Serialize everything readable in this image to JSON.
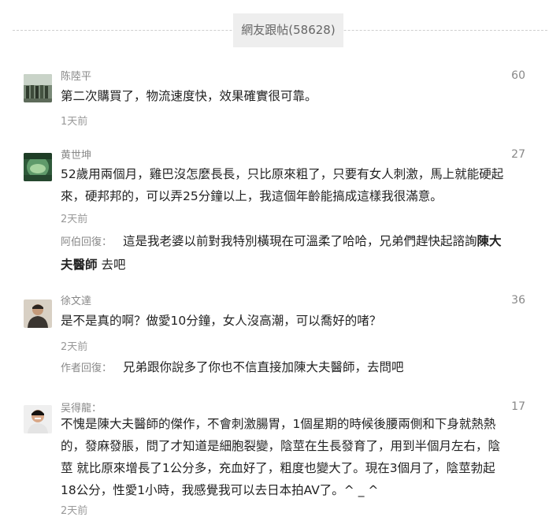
{
  "header": {
    "title": "網友跟帖(58628)"
  },
  "comments": [
    {
      "user": "陈陸平",
      "likes": "60",
      "content": "第二次購買了，物流速度快，效果確實很可靠。",
      "time": "1天前"
    },
    {
      "user": "黄世坤",
      "likes": "27",
      "content_line1": "52歲用兩個月，雞巴沒怎麼長長，只比原來粗了，只要有女人刺激，馬上就能硬起",
      "content_line2": "來，硬邦邦的，可以弄25分鐘以上，我這個年齡能搞成這樣我很滿意。",
      "time": "2天前",
      "reply": {
        "label": "阿伯回復：",
        "text_line1_a": "這是我老婆以前對我特別橫現在可溫柔了哈哈，兄弟們趕快起諮詢",
        "bold_a": "陳大",
        "bold_b": "夫醫師",
        "text_line2_b": " 去吧"
      }
    },
    {
      "user": "徐文達",
      "likes": "36",
      "content": "是不是真的啊？做愛10分鐘，女人沒高潮，可以喬好的啫？",
      "time": "2天前",
      "reply": {
        "label": "作者回復：",
        "text": "兄弟跟你說多了你也不信直接加陳大夫醫師，去問吧"
      }
    },
    {
      "user": "吴得龍：",
      "likes": "17",
      "content_line1": "不愧是陳大夫醫師的傑作，不會刺激腸胃，1個星期的時候後腰兩側和下身就熱熱",
      "content_line2": "的，發麻發脹，問了才知道是細胞裂變，陰莖在生長發育了，用到半個月左右，陰",
      "content_line3": "莖 就比原來增長了1公分多，充血好了，粗度也變大了。現在3個月了，陰莖勃起",
      "content_line4": "18公分，性愛1小時，我感覺我可以去日本拍AV了。^ _ ^",
      "time": "2天前"
    }
  ]
}
